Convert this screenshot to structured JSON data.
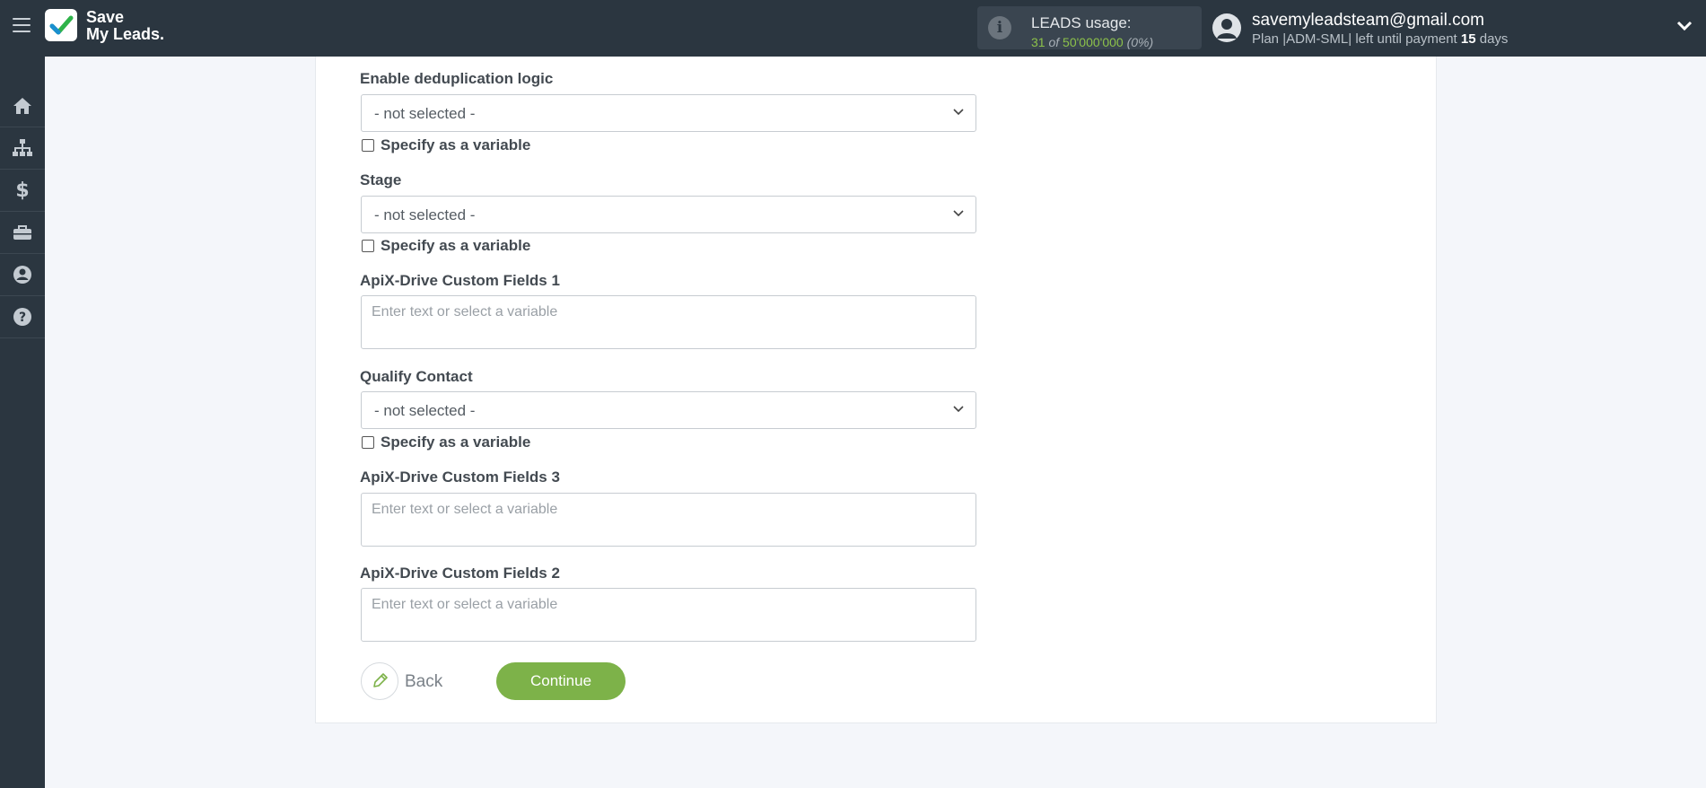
{
  "app": {
    "logo_line1": "Save",
    "logo_line2": "My Leads."
  },
  "header": {
    "usage_title": "LEADS usage:",
    "usage_used": "31",
    "usage_of": "of",
    "usage_total": "50'000'000",
    "usage_pct": "(0%)",
    "email": "savemyleadsteam@gmail.com",
    "plan_prefix": "Plan |ADM-SML| left until payment",
    "plan_days": "15",
    "plan_suffix": "days"
  },
  "sidebar": {
    "icons": [
      "home-icon",
      "sitemap-icon",
      "dollar-icon",
      "briefcase-icon",
      "user-icon",
      "help-icon"
    ]
  },
  "form": {
    "fields": [
      {
        "label": "Enable deduplication logic",
        "type": "select",
        "value": "- not selected -",
        "variable_label": "Specify as a variable"
      },
      {
        "label": "Stage",
        "type": "select",
        "value": "- not selected -",
        "variable_label": "Specify as a variable"
      },
      {
        "label": "ApiX-Drive Custom Fields 1",
        "type": "text",
        "placeholder": "Enter text or select a variable"
      },
      {
        "label": "Qualify Contact",
        "type": "select",
        "value": "- not selected -",
        "variable_label": "Specify as a variable"
      },
      {
        "label": "ApiX-Drive Custom Fields 3",
        "type": "text",
        "placeholder": "Enter text or select a variable"
      },
      {
        "label": "ApiX-Drive Custom Fields 2",
        "type": "text",
        "placeholder": "Enter text or select a variable"
      }
    ],
    "back_label": "Back",
    "continue_label": "Continue"
  },
  "colors": {
    "topbar": "#2b3640",
    "accent_green": "#7db249",
    "background": "#f4f6fa"
  }
}
